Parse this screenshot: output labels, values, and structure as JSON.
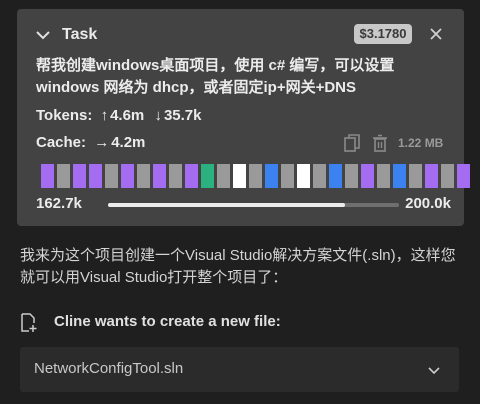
{
  "task": {
    "title": "Task",
    "cost": "$3.1780",
    "text": "帮我创建windows桌面项目，使用 c# 编写，可以设置windows 网络为 dhcp，或者固定ip+网关+DNS",
    "tokens_label": "Tokens:",
    "tokens_in": "4.6m",
    "tokens_out": "35.7k",
    "cache_label": "Cache:",
    "cache_value": "4.2m",
    "cache_size": "1.22 MB",
    "context_used": "162.7k",
    "context_max": "200.0k",
    "context_fraction": 0.8135
  },
  "context_segments": [
    "#a46cf0",
    "#9a9a9a",
    "#a46cf0",
    "#a46cf0",
    "#9a9a9a",
    "#a46cf0",
    "#9a9a9a",
    "#a46cf0",
    "#9a9a9a",
    "#a46cf0",
    "#2bb07f",
    "#9a9a9a",
    "#ffffff",
    "#9a9a9a",
    "#3b82f0",
    "#9a9a9a",
    "#ffffff",
    "#9a9a9a",
    "#3b82f0",
    "#9a9a9a",
    "#a46cf0",
    "#9a9a9a",
    "#3b82f0",
    "#9a9a9a",
    "#a46cf0",
    "#9a9a9a",
    "#a46cf0"
  ],
  "message": "我来为这个项目创建一个Visual Studio解决方案文件(.sln)，这样您就可以用Visual Studio打开整个项目了：",
  "file": {
    "title": "Cline wants to create a new file:",
    "name": "NetworkConfigTool.sln"
  },
  "colors": {
    "background": "#1f1f1f",
    "card": "#434343",
    "badge": "#c8c8c8",
    "text": "#ececec"
  }
}
